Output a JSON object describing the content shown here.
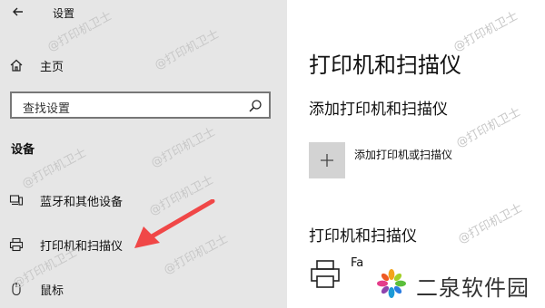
{
  "window": {
    "title": "设置"
  },
  "sidebar": {
    "home_label": "主页",
    "search_placeholder": "查找设置",
    "section_title": "设备",
    "items": [
      {
        "label": "蓝牙和其他设备",
        "icon": "bluetooth-devices-icon"
      },
      {
        "label": "打印机和扫描仪",
        "icon": "printer-icon"
      },
      {
        "label": "鼠标",
        "icon": "mouse-icon"
      }
    ]
  },
  "main": {
    "page_title": "打印机和扫描仪",
    "add_section_title": "添加打印机和扫描仪",
    "add_button_label": "添加打印机或扫描仪",
    "printers_section_title": "打印机和扫描仪",
    "printers": [
      {
        "name": "Fa",
        "icon": "printer-icon"
      }
    ]
  },
  "watermark": "@打印机卫士",
  "brand": {
    "text": "二泉软件园"
  },
  "colors": {
    "sidebar_bg": "#e6e6e6",
    "add_button_bg": "#d3d3d3",
    "arrow": "#f04747"
  }
}
